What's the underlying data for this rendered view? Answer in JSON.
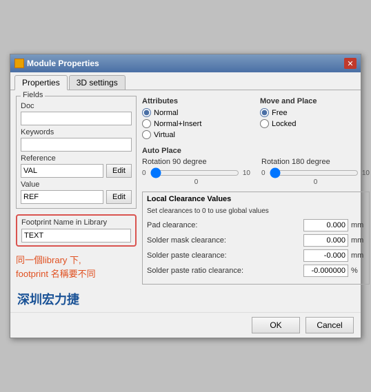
{
  "window": {
    "title": "Module Properties",
    "close_label": "✕"
  },
  "tabs": [
    {
      "label": "Properties",
      "active": true
    },
    {
      "label": "3D settings",
      "active": false
    }
  ],
  "left": {
    "fields_group": "Fields",
    "doc_label": "Doc",
    "doc_value": "",
    "keywords_label": "Keywords",
    "keywords_value": "",
    "reference_label": "Reference",
    "reference_value": "VAL",
    "reference_edit": "Edit",
    "value_label": "Value",
    "value_value": "REF",
    "value_edit": "Edit",
    "footprint_label": "Footprint Name in Library",
    "footprint_value": "TEXT",
    "annotation_line1": "同一個library 下,",
    "annotation_line2": "footprint 名稱要不同",
    "chinese_brand": "深圳宏力捷"
  },
  "right": {
    "attributes_title": "Attributes",
    "attr_options": [
      "Normal",
      "Normal+Insert",
      "Virtual"
    ],
    "attr_selected": 0,
    "move_place_title": "Move and Place",
    "move_options": [
      "Free",
      "Locked"
    ],
    "move_selected": 0,
    "auto_place_title": "Auto Place",
    "rotation_90_label": "Rotation 90 degree",
    "rotation_180_label": "Rotation 180 degree",
    "rotation_90_min": "0",
    "rotation_90_max": "10",
    "rotation_90_value": "0",
    "rotation_180_min": "0",
    "rotation_180_max": "10",
    "rotation_180_value": "0",
    "clearance_title": "Local Clearance Values",
    "clearance_subtitle": "Set clearances to 0 to use global values",
    "clearances": [
      {
        "name": "Pad clearance:",
        "value": "0.000",
        "unit": "mm"
      },
      {
        "name": "Solder mask clearance:",
        "value": "0.000",
        "unit": "mm"
      },
      {
        "name": "Solder paste clearance:",
        "value": "-0.000",
        "unit": "mm"
      },
      {
        "name": "Solder paste ratio clearance:",
        "value": "-0.000000",
        "unit": "%"
      }
    ]
  },
  "buttons": {
    "ok": "OK",
    "cancel": "Cancel"
  }
}
